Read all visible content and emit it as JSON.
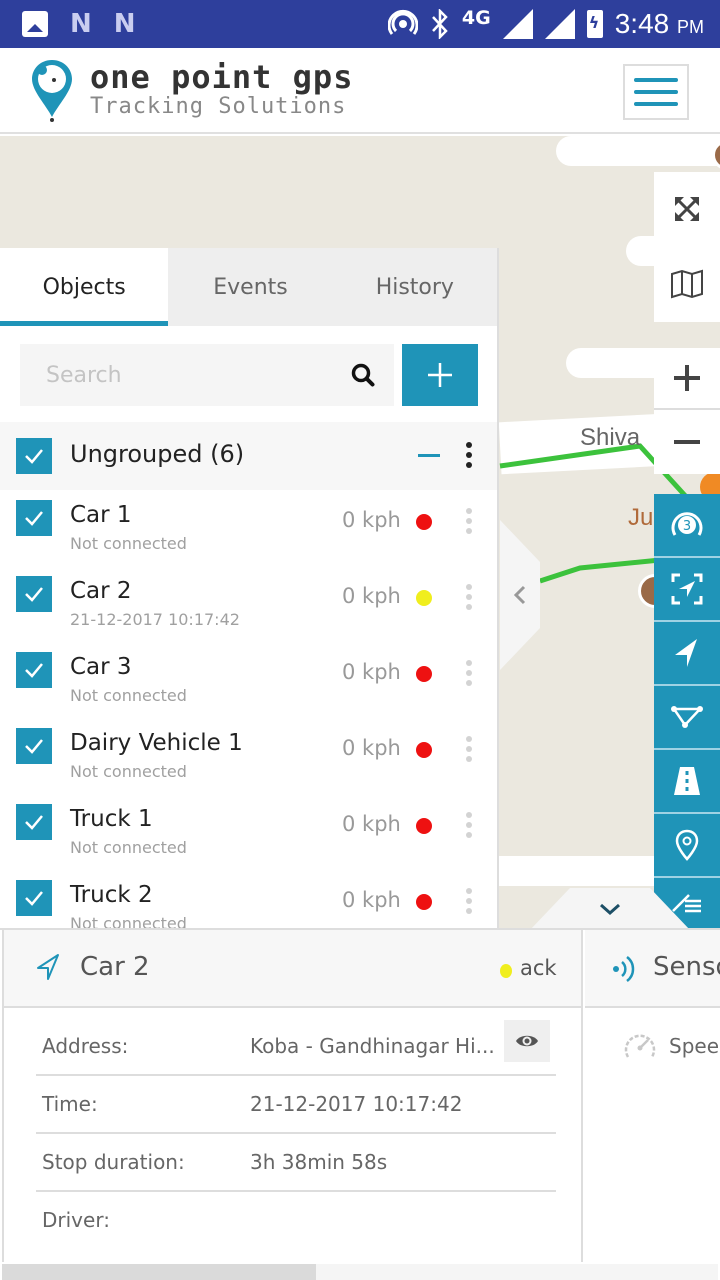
{
  "status_bar": {
    "time": "3:48",
    "ampm": "PM",
    "network": "4G",
    "icons": [
      "image-icon",
      "n-notification-icon",
      "n-notification-icon",
      "hotspot-icon",
      "bluetooth-icon",
      "signal-icon",
      "signal-icon",
      "battery-charging-icon"
    ]
  },
  "header": {
    "brand": "one point gps",
    "tagline": "Tracking Solutions",
    "menu_icon": "hamburger-icon"
  },
  "colors": {
    "accent": "#1f94b8",
    "status_bar": "#2e3f9c",
    "offline": "#ee1111",
    "idle": "#f0ee1e",
    "route": "#3cc23c"
  },
  "tabs": [
    {
      "label": "Objects",
      "active": true
    },
    {
      "label": "Events",
      "active": false
    },
    {
      "label": "History",
      "active": false
    }
  ],
  "search": {
    "placeholder": "Search",
    "value": ""
  },
  "group": {
    "label": "Ungrouped (6)",
    "checked": true
  },
  "objects": [
    {
      "name": "Car 1",
      "sub": "Not connected",
      "speed": "0 kph",
      "status": "offline",
      "checked": true
    },
    {
      "name": "Car 2",
      "sub": "21-12-2017 10:17:42",
      "speed": "0 kph",
      "status": "idle",
      "checked": true
    },
    {
      "name": "Car 3",
      "sub": "Not connected",
      "speed": "0 kph",
      "status": "offline",
      "checked": true
    },
    {
      "name": "Dairy Vehicle 1",
      "sub": "Not connected",
      "speed": "0 kph",
      "status": "offline",
      "checked": true
    },
    {
      "name": "Truck 1",
      "sub": "Not connected",
      "speed": "0 kph",
      "status": "offline",
      "checked": true
    },
    {
      "name": "Truck 2",
      "sub": "Not connected",
      "speed": "0 kph",
      "status": "offline",
      "checked": true
    }
  ],
  "map": {
    "labels": [
      "Shiva",
      "Ju"
    ],
    "controls": [
      "fullscreen-icon",
      "map-layers-icon",
      "zoom-in-icon",
      "zoom-out-icon"
    ],
    "tools": [
      "cluster-count-icon",
      "fit-objects-icon",
      "navigate-icon",
      "polygon-icon",
      "road-icon",
      "marker-icon",
      "ruler-icon"
    ],
    "cluster_count": "3"
  },
  "details": {
    "title": "Car 2",
    "status": "ack",
    "rows": [
      {
        "label": "Address:",
        "value": "Koba - Gandhinagar Hi..."
      },
      {
        "label": "Time:",
        "value": "21-12-2017 10:17:42"
      },
      {
        "label": "Stop duration:",
        "value": "3h 38min 58s"
      },
      {
        "label": "Driver:",
        "value": ""
      }
    ]
  },
  "sensors": {
    "title": "Sensors",
    "items": [
      {
        "label": "Speed"
      }
    ]
  }
}
